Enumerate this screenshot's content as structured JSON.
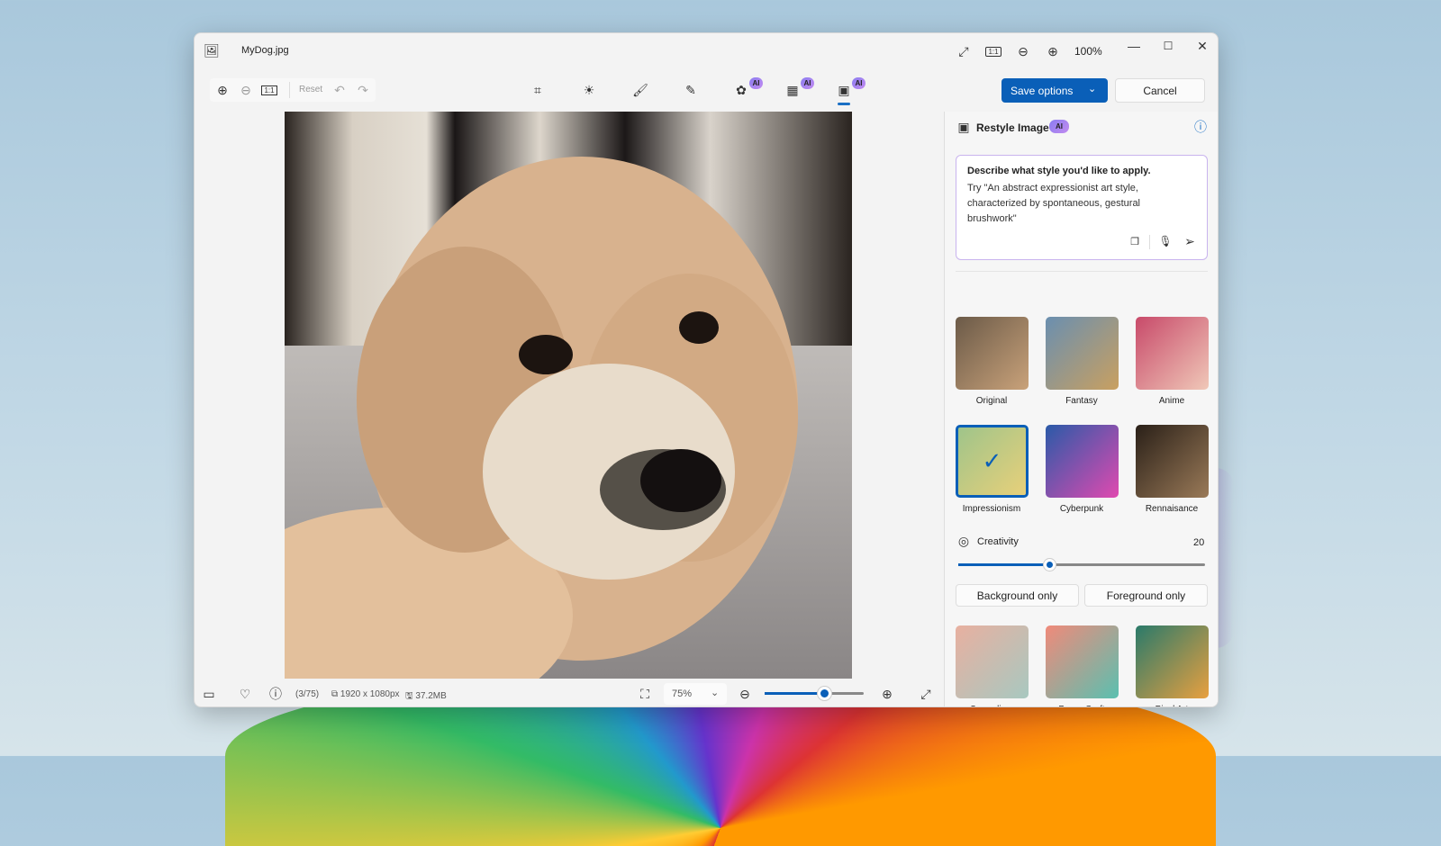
{
  "title": "MyDog.jpg",
  "titlebar": {
    "zoom": "100%"
  },
  "toolbar": {
    "reset": "Reset",
    "ai_badge": "AI"
  },
  "actions": {
    "save": "Save options",
    "cancel": "Cancel"
  },
  "panel": {
    "title": "Restyle Image",
    "badge": "AI",
    "prompt_title": "Describe what style you'd like to apply.",
    "prompt_hint": "Try \"An abstract expressionist art style, characterized by spontaneous, gestural brushwork\"",
    "styles": [
      {
        "label": "Original",
        "selected": false,
        "colors": [
          "#6b5a48",
          "#c9a27a"
        ]
      },
      {
        "label": "Fantasy",
        "selected": false,
        "colors": [
          "#6a8fb0",
          "#c9a060"
        ]
      },
      {
        "label": "Anime",
        "selected": false,
        "colors": [
          "#c84a6a",
          "#f0c8b8"
        ]
      },
      {
        "label": "Impressionism",
        "selected": true,
        "colors": [
          "#9fc48a",
          "#e8d07a"
        ]
      },
      {
        "label": "Cyberpunk",
        "selected": false,
        "colors": [
          "#2a5aa8",
          "#e04ab0"
        ]
      },
      {
        "label": "Rennaisance",
        "selected": false,
        "colors": [
          "#2a2018",
          "#9a7a58"
        ]
      }
    ],
    "creativity": {
      "label": "Creativity",
      "value": "20",
      "fraction": 0.37
    },
    "scope": {
      "background": "Background only",
      "foreground": "Foreground only"
    },
    "more_styles": [
      {
        "label": "Surrealism",
        "colors": [
          "#e8b0a0",
          "#a8c8c0"
        ]
      },
      {
        "label": "Paper Craft",
        "colors": [
          "#f08a7a",
          "#5ac0b0"
        ]
      },
      {
        "label": "Pixel Art",
        "colors": [
          "#2a7a6a",
          "#e8a040"
        ]
      }
    ]
  },
  "statusbar": {
    "index": "(3/75)",
    "dimensions": "1920 x 1080px",
    "size": "37.2MB",
    "zoom": "75%",
    "zoom_fraction": 0.6
  }
}
